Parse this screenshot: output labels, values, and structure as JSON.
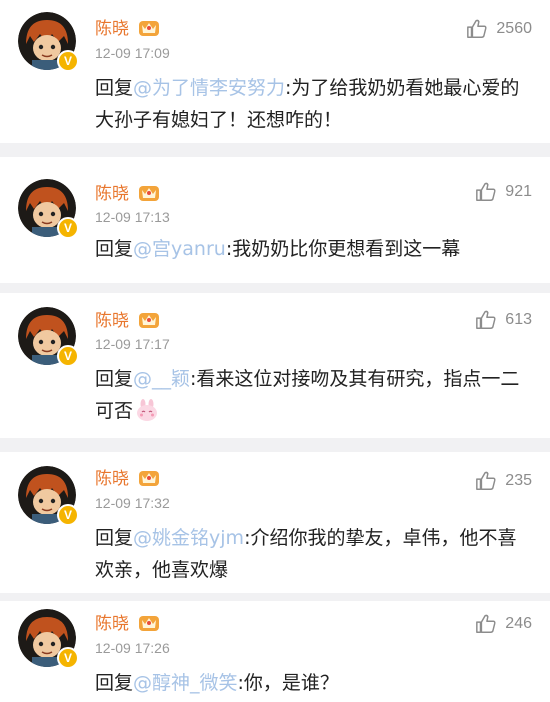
{
  "comments": [
    {
      "username": "陈晓",
      "time": "12-09 17:09",
      "likes": "2560",
      "prefix": "回复",
      "mention": "@为了情李安努力",
      "text": ":为了给我奶奶看她最心爱的大孙子有媳妇了！还想咋的！"
    },
    {
      "username": "陈晓",
      "time": "12-09 17:13",
      "likes": "921",
      "prefix": "回复",
      "mention": "@宫yanru",
      "text": ":我奶奶比你更想看到这一幕"
    },
    {
      "username": "陈晓",
      "time": "12-09 17:17",
      "likes": "613",
      "prefix": "回复",
      "mention": "@__颖",
      "text": ":看来这位对接吻及其有研究，指点一二可否"
    },
    {
      "username": "陈晓",
      "time": "12-09 17:32",
      "likes": "235",
      "prefix": "回复",
      "mention": "@姚金铭yjm",
      "text": ":介绍你我的挚友，卓伟，他不喜欢亲，他喜欢爆"
    },
    {
      "username": "陈晓",
      "time": "12-09 17:26",
      "likes": "246",
      "prefix": "回复",
      "mention": "@醇神_微笑",
      "text": ":你，是谁？"
    }
  ],
  "icons": {
    "like": "thumbs-up-icon",
    "verified": "verified-badge-icon",
    "member": "vip-crown-icon",
    "emoji": "bunny-emoji-icon"
  },
  "colors": {
    "username": "#e8762d",
    "mention": "#a7c3e6",
    "separator": "#f1f1f3"
  }
}
